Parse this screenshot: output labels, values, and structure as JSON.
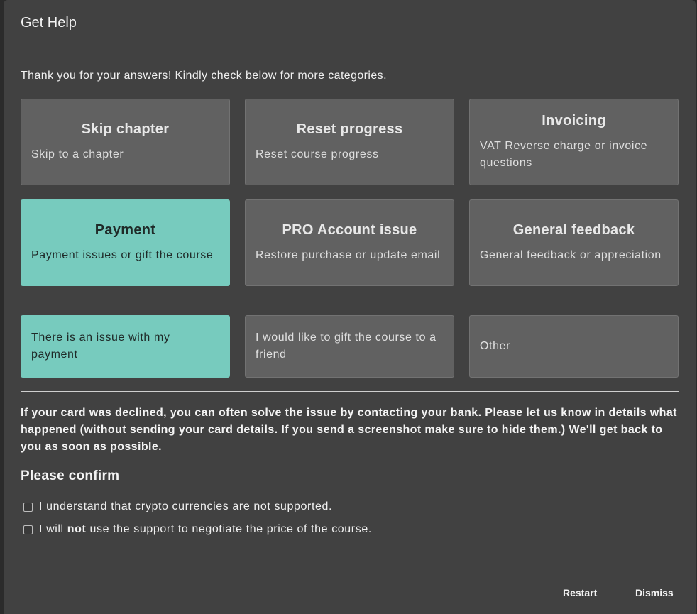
{
  "dialog": {
    "title": "Get Help",
    "intro": "Thank you for your answers! Kindly check below for more categories."
  },
  "categories": [
    {
      "title": "Skip chapter",
      "subtitle": "Skip to a chapter",
      "selected": false
    },
    {
      "title": "Reset progress",
      "subtitle": "Reset course progress",
      "selected": false
    },
    {
      "title": "Invoicing",
      "subtitle": "VAT Reverse charge or invoice questions",
      "selected": false
    },
    {
      "title": "Payment",
      "subtitle": "Payment issues or gift the course",
      "selected": true
    },
    {
      "title": "PRO Account issue",
      "subtitle": "Restore purchase or update email",
      "selected": false
    },
    {
      "title": "General feedback",
      "subtitle": "General feedback or appreciation",
      "selected": false
    }
  ],
  "options": [
    {
      "label": "There is an issue with my payment",
      "selected": true
    },
    {
      "label": "I would like to gift the course to a friend",
      "selected": false
    },
    {
      "label": "Other",
      "selected": false
    }
  ],
  "notice": "If your card was declined, you can often solve the issue by contacting your bank. Please let us know in details what happened (without sending your card details. If you send a screenshot make sure to hide them.) We'll get back to you as soon as possible.",
  "confirm": {
    "heading": "Please confirm",
    "check1": "I understand that crypto currencies are not supported.",
    "check2_pre": "I will ",
    "check2_bold": "not",
    "check2_post": " use the support to negotiate the price of the course."
  },
  "footer": {
    "restart": "Restart",
    "dismiss": "Dismiss"
  },
  "colors": {
    "accent": "#77cbbe",
    "card": "#616161",
    "dialog_bg": "#414141"
  }
}
